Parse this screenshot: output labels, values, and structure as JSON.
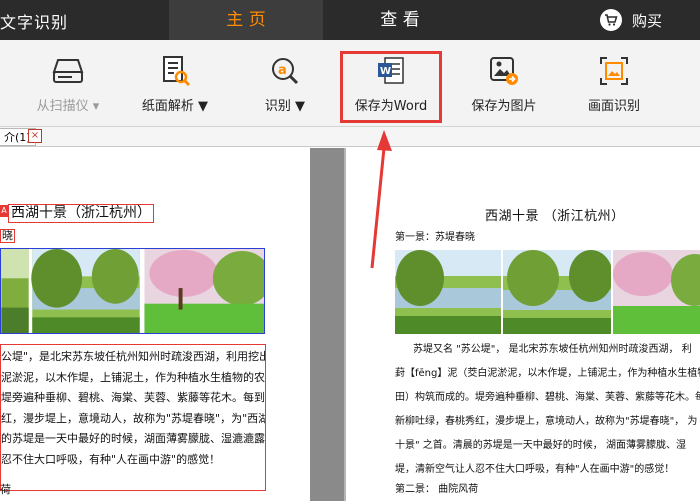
{
  "app": {
    "title": "文字识别"
  },
  "tabs": [
    {
      "label": "主 页",
      "active": true
    },
    {
      "label": "查 看",
      "active": false
    }
  ],
  "buy": {
    "label": "购买",
    "icon": "cart-icon"
  },
  "toolbar": {
    "scan": {
      "label": "从扫描仪 ▾",
      "icon": "scanner-icon"
    },
    "parse": {
      "label": "纸面解析 ▼",
      "icon": "document-scan-icon"
    },
    "ocr": {
      "label": "识别 ▼",
      "icon": "recognize-icon"
    },
    "save_word": {
      "label": "保存为Word",
      "icon": "word-icon"
    },
    "save_image": {
      "label": "保存为图片",
      "icon": "image-export-icon"
    },
    "screen_ocr": {
      "label": "画面识别",
      "icon": "screen-capture-icon"
    }
  },
  "doc_tab": {
    "label": "介(1)",
    "close": "×"
  },
  "left_doc": {
    "marker": "A",
    "title": "西湖十景（浙江杭州）",
    "sub": "晓",
    "lines": [
      "公堤\"，是北宋苏东坡任杭州知州时疏浚西湖，利用挖出的",
      "泥淤泥，以木作堤，上铺泥土，作为种植水生植物的农田，叫荐",
      "堤旁遍种垂柳、碧桃、海棠、芙蓉、紫藤等花木。每到春季，",
      "红，漫步堤上，意境动人，故称为\"苏堤春晓\"，为\"西湖",
      "的苏堤是一天中最好的时候，湖面薄雾朦胧、湿漉漉露水满",
      "忍不住大口呼吸，有种\"人在画中游\"的感觉！"
    ],
    "foot": "荷"
  },
  "right_doc": {
    "title": "西湖十景 （浙江杭州）",
    "sub": "第一景：苏堤春晓",
    "lines": [
      "苏堤又名  \"苏公堤\"，  是北宋苏东坡任杭州知州时疏浚西湖，  利",
      "葑【fēng】泥（茭白泥淤泥，以木作堤，上铺泥土，作为种植水生植物的农田，",
      "田）构筑而成的。堤旁遍种垂柳、碧桃、海棠、芙蓉、紫藤等花木。每",
      "新柳吐绿，春桃秀红，漫步堤上，意境动人，故称为\"苏堤春晓\"，  为",
      "十景\" 之首。清晨的苏堤是一天中最好的时候，  湖面薄雾朦胧、湿",
      "堤，清新空气让人忍不住大口呼吸，有种\"人在画中游\"的感觉！"
    ],
    "foot": "第二景：    曲院风荷"
  },
  "colors": {
    "topbar": "#2b2b2b",
    "accent": "#ff8c00",
    "highlight": "#e53935",
    "ribbon": "#f3f3f3"
  }
}
